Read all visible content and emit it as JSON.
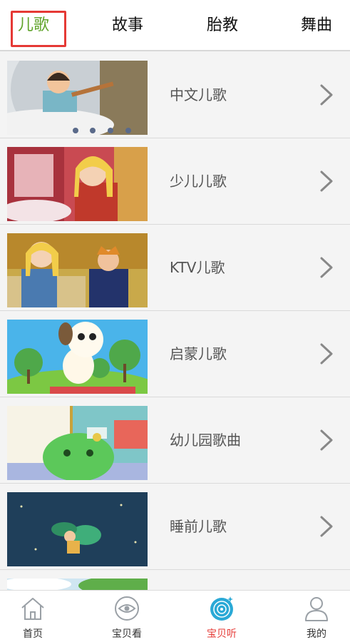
{
  "tabs": [
    {
      "label": "儿歌",
      "active": true
    },
    {
      "label": "故事",
      "active": false
    },
    {
      "label": "胎教",
      "active": false
    },
    {
      "label": "舞曲",
      "active": false
    }
  ],
  "list": [
    {
      "label": "中文儿歌"
    },
    {
      "label": "少儿儿歌"
    },
    {
      "label": "KTV儿歌"
    },
    {
      "label": "启蒙儿歌"
    },
    {
      "label": "幼儿园歌曲"
    },
    {
      "label": "睡前儿歌"
    }
  ],
  "bottom_nav": [
    {
      "label": "首页",
      "icon": "home-icon",
      "active": false
    },
    {
      "label": "宝贝看",
      "icon": "eye-icon",
      "active": false
    },
    {
      "label": "宝贝听",
      "icon": "disc-icon",
      "active": true
    },
    {
      "label": "我的",
      "icon": "user-icon",
      "active": false
    }
  ],
  "colors": {
    "active_tab": "#5fa32a",
    "highlight_border": "#e53935",
    "active_nav": "#e53935",
    "nav_icon": "#9aa0a6"
  }
}
